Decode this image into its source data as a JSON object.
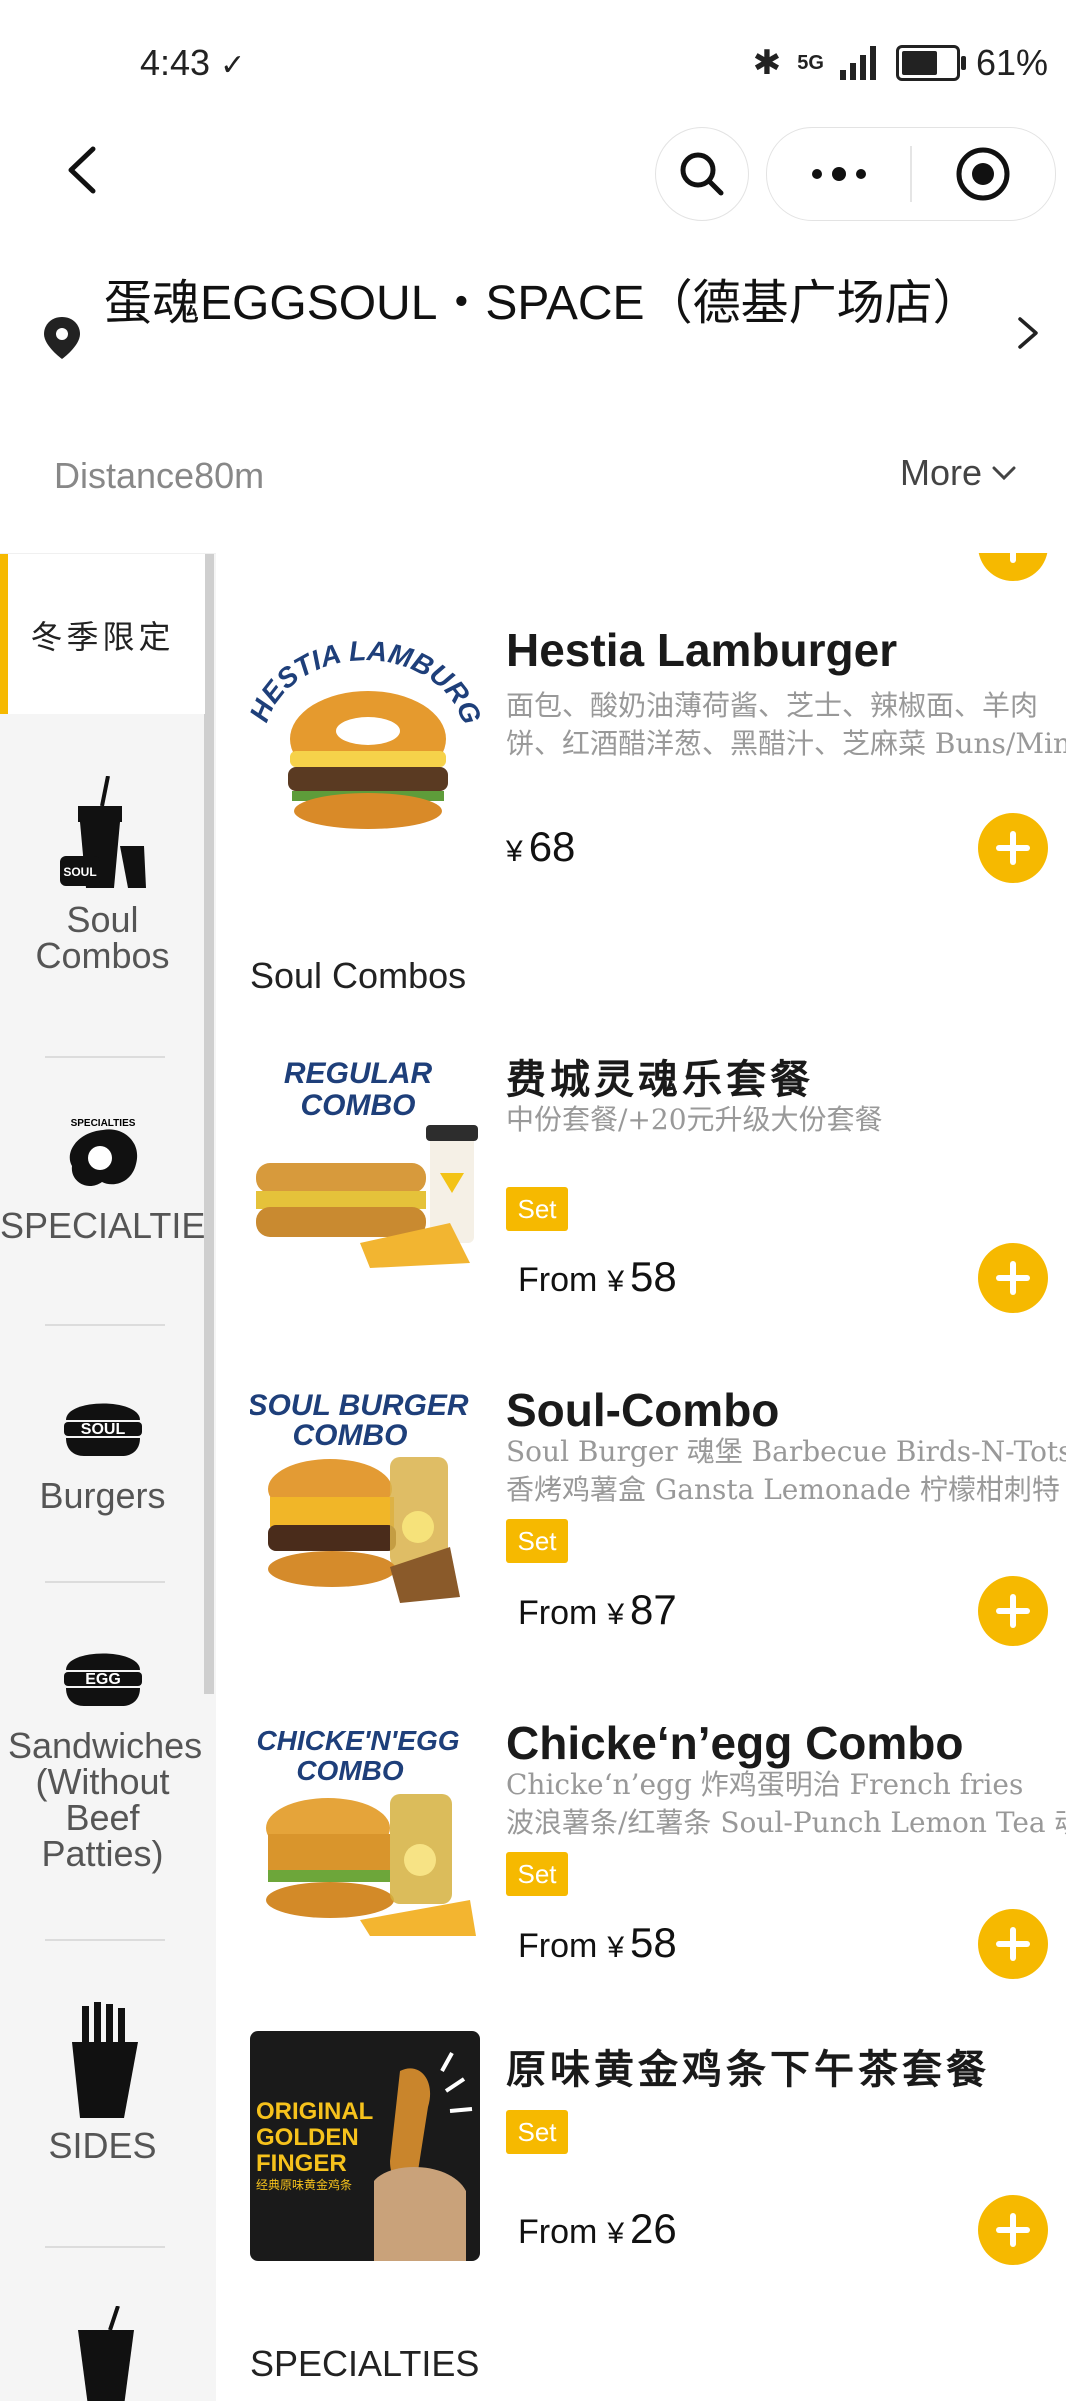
{
  "status": {
    "time": "4:43",
    "network": "5G",
    "battery": "61%",
    "battery_level": 0.61
  },
  "header": {
    "store_name": "蛋魂EGGSOUL・SPACE（德基广场店）",
    "distance": "Distance80m",
    "more_label": "More"
  },
  "sidebar": {
    "items": [
      {
        "label": "冬季限定",
        "active": true
      },
      {
        "label": "Soul Combos"
      },
      {
        "label": "SPECIALTIES"
      },
      {
        "label": "Burgers"
      },
      {
        "label": "Sandwiches (Without Beef Patties)"
      },
      {
        "label": "SIDES"
      }
    ]
  },
  "menu": {
    "items": [
      {
        "name": "Hestia Lamburger",
        "desc1": "面包、酸奶油薄荷酱、芝士、辣椒面、羊肉",
        "desc2": "饼、红酒醋洋葱、黑醋汁、芝麻菜 Buns/Mint",
        "currency": "¥",
        "price": "68",
        "img_text": "HESTIA LAMBURGER"
      },
      {
        "name": "费城灵魂乐套餐",
        "desc1": "中份套餐/+20元升级大份套餐",
        "badge": "Set",
        "from": "From",
        "currency": "¥",
        "price": "58",
        "img_text_1": "REGULAR",
        "img_text_2": "COMBO"
      },
      {
        "name": "Soul-Combo",
        "desc1": "Soul Burger 魂堡 Barbecue Birds-N-Tots",
        "desc2": "香烤鸡薯盒 Gansta Lemonade 柠檬柑刺特",
        "badge": "Set",
        "from": "From",
        "currency": "¥",
        "price": "87",
        "img_text_1": "SOUL BURGER",
        "img_text_2": "COMBO"
      },
      {
        "name": "Chicke‘n’egg Combo",
        "desc1": "Chicke‘n’egg 炸鸡蛋明治 French fries",
        "desc2": "波浪薯条/红薯条 Soul-Punch Lemon Tea 魂",
        "badge": "Set",
        "from": "From",
        "currency": "¥",
        "price": "58",
        "img_text_1": "CHICKE'N'EGG",
        "img_text_2": "COMBO"
      },
      {
        "name": "原味黄金鸡条下午茶套餐",
        "badge": "Set",
        "from": "From",
        "currency": "¥",
        "price": "26",
        "img_text_1": "ORIGINAL",
        "img_text_2": "GOLDEN",
        "img_text_3": "FINGER",
        "img_text_4": "经典原味黄金鸡条"
      }
    ],
    "section_soul_combos": "Soul Combos",
    "section_specialties": "SPECIALTIES"
  },
  "colors": {
    "accent": "#f6b900",
    "sidebar_bg": "#f5f5f5"
  }
}
